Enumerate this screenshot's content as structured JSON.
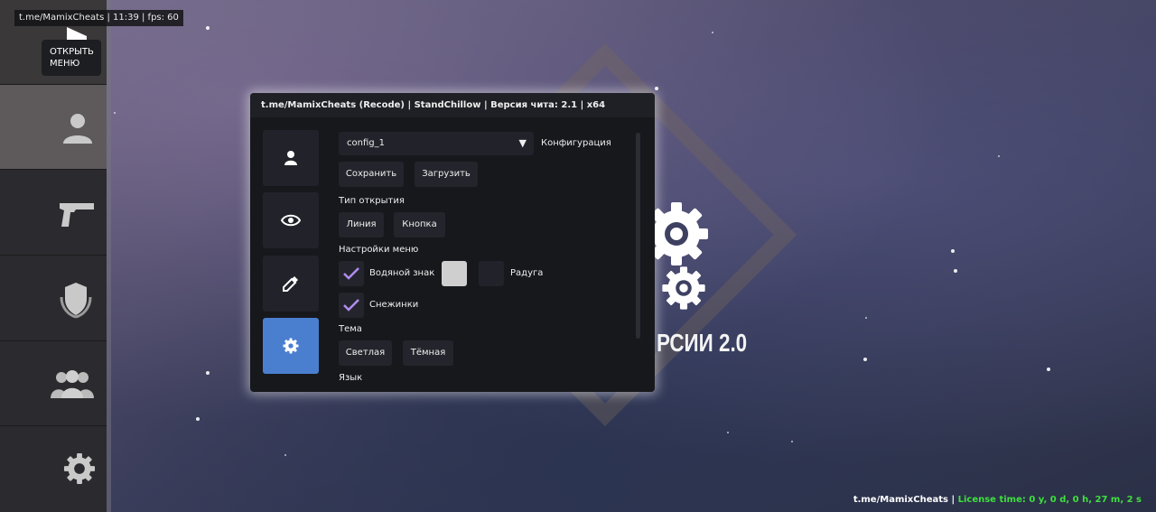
{
  "info_bar": "t.me/MamixCheats | 11:39 | fps: 60",
  "open_menu": {
    "line1": "ОТКРЫТЬ",
    "line2": "МЕНЮ"
  },
  "background": {
    "text": "РСИИ 2.0"
  },
  "menu": {
    "title": "t.me/MamixCheats (Recode) | StandChillow | Версия чита: 2.1 | x64",
    "config": {
      "selected": "config_1",
      "label": "Конфигурация",
      "save": "Сохранить",
      "load": "Загрузить"
    },
    "open_type": {
      "title": "Тип открытия",
      "line": "Линия",
      "button": "Кнопка"
    },
    "menu_settings": {
      "title": "Настройки меню",
      "watermark": "Водяной знак",
      "watermark_checked": true,
      "rainbow": "Радуга",
      "snowflakes": "Снежинки",
      "snowflakes_checked": true
    },
    "theme": {
      "title": "Тема",
      "light": "Светлая",
      "dark": "Тёмная"
    },
    "language": {
      "title": "Язык"
    }
  },
  "colors": {
    "accent_tab": "#4a7fd0",
    "check": "#b08cf0",
    "swatch_light": "#cfcfcf",
    "swatch_dark": "#22232a",
    "license_green": "#3ee03e"
  },
  "license": {
    "prefix": "t.me/MamixCheats | ",
    "time": "License time: 0 y, 0 d, 0 h, 27 m, 2 s"
  }
}
